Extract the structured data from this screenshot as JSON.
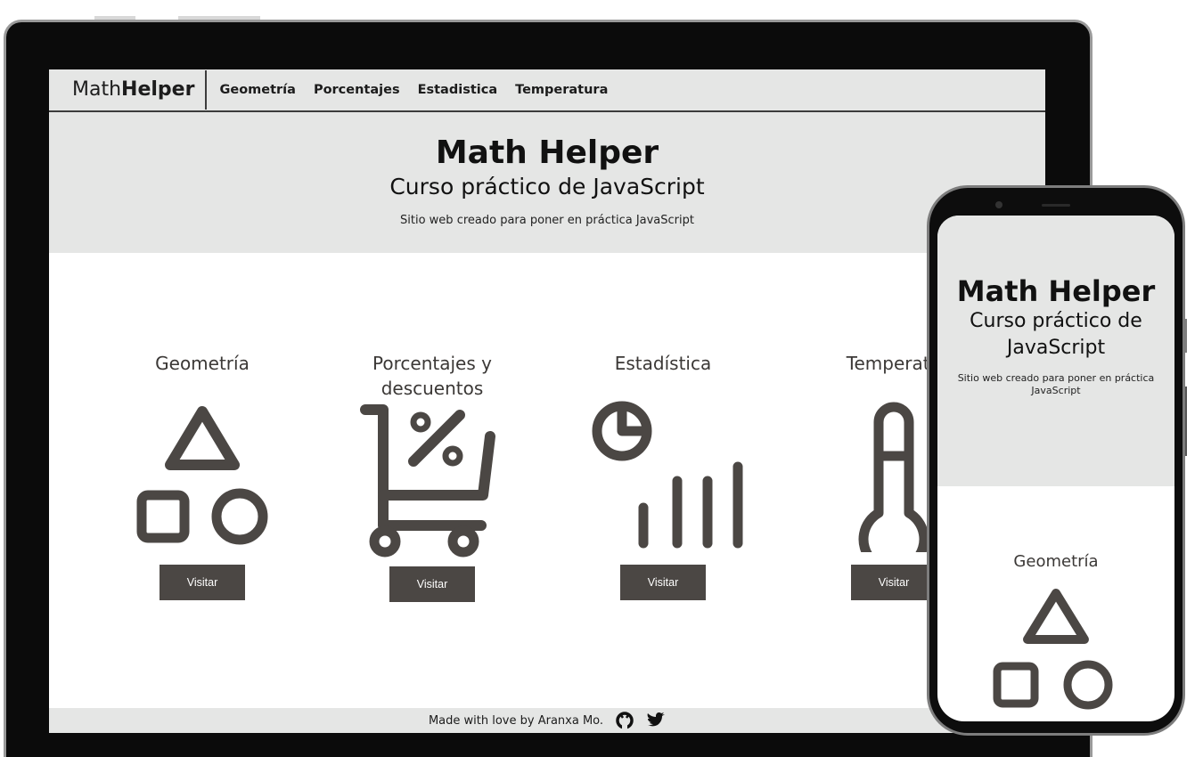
{
  "nav": {
    "logo_light": "Math",
    "logo_bold": "Helper",
    "links": [
      "Geometría",
      "Porcentajes",
      "Estadistica",
      "Temperatura"
    ]
  },
  "hero": {
    "title": "Math Helper",
    "subtitle": "Curso práctico de JavaScript",
    "description": "Sitio web creado para poner en práctica JavaScript"
  },
  "cards": [
    {
      "title": "Geometría",
      "icon": "shapes-icon",
      "button": "Visitar"
    },
    {
      "title": "Porcentajes y descuentos",
      "icon": "percent-cart-icon",
      "button": "Visitar"
    },
    {
      "title": "Estadística",
      "icon": "pie-chart-bars-icon",
      "button": "Visitar"
    },
    {
      "title": "Temperatu",
      "icon": "thermometer-icon",
      "button": "Visitar"
    }
  ],
  "footer": {
    "text": "Made with love by Aranxa Mo.",
    "icons": [
      "github-icon",
      "twitter-icon"
    ]
  },
  "phone": {
    "title": "Math Helper",
    "subtitle": "Curso práctico de JavaScript",
    "description": "Sitio web creado para poner en práctica JavaScript",
    "card_title": "Geometría"
  },
  "colors": {
    "panel_bg": "#e5e6e5",
    "icon": "#4b4744",
    "button_bg": "#4b4744",
    "device_frame": "#0b0b0b"
  }
}
